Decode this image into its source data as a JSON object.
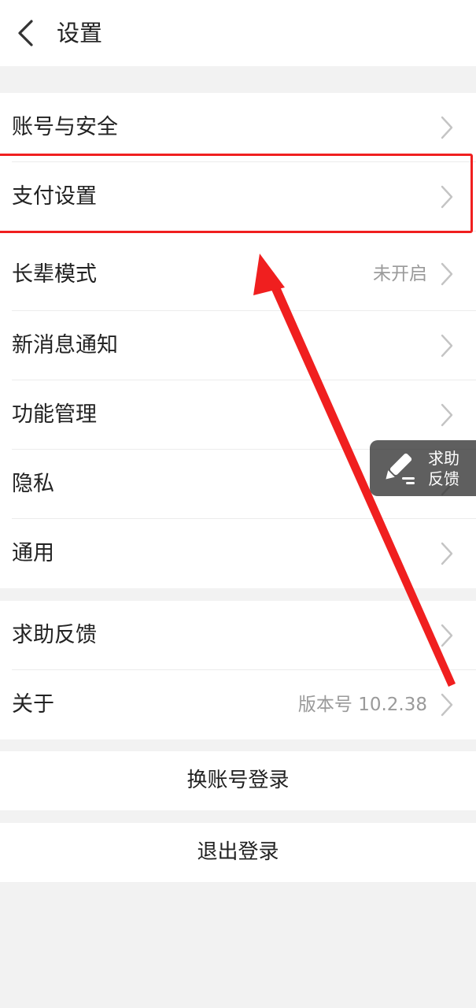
{
  "header": {
    "title": "设置",
    "back_icon": "chevron-left-icon"
  },
  "settings": {
    "group1": [
      {
        "label": "账号与安全",
        "value": ""
      },
      {
        "label": "支付设置",
        "value": ""
      },
      {
        "label": "长辈模式",
        "value": "未开启"
      },
      {
        "label": "新消息通知",
        "value": ""
      },
      {
        "label": "功能管理",
        "value": ""
      },
      {
        "label": "隐私",
        "value": ""
      },
      {
        "label": "通用",
        "value": ""
      }
    ],
    "group2": [
      {
        "label": "求助反馈",
        "value": ""
      },
      {
        "label": "关于",
        "value": "版本号 10.2.38"
      }
    ]
  },
  "actions": {
    "switch_account": "换账号登录",
    "logout": "退出登录"
  },
  "floating_help": {
    "line1": "求助",
    "line2": "反馈",
    "icon": "pencil-icon"
  },
  "annotation": {
    "highlighted_item": "支付设置",
    "color": "#f01f1f"
  },
  "colors": {
    "background": "#f2f2f2",
    "surface": "#ffffff",
    "text": "#222222",
    "secondary_text": "#9a9a9a",
    "chevron": "#c4c4c4"
  }
}
